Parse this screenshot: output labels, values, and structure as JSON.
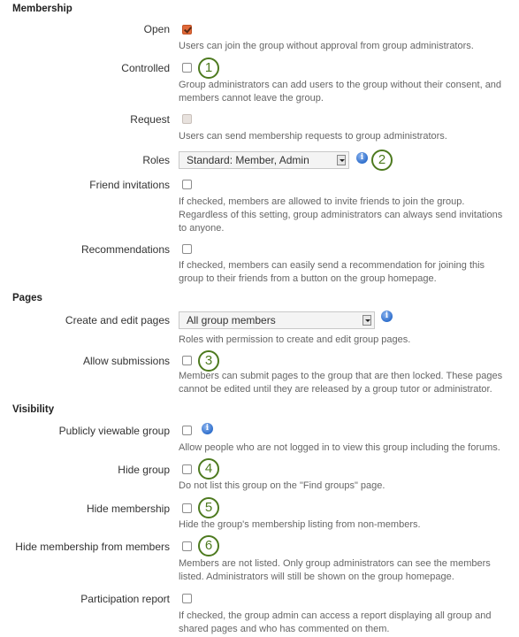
{
  "sections": {
    "membership": "Membership",
    "pages": "Pages",
    "visibility": "Visibility"
  },
  "fields": {
    "open": {
      "label": "Open",
      "checked": true,
      "desc": "Users can join the group without approval from group administrators."
    },
    "controlled": {
      "label": "Controlled",
      "checked": false,
      "callout": "1",
      "desc": "Group administrators can add users to the group without their consent, and members cannot leave the group."
    },
    "request": {
      "label": "Request",
      "checked": false,
      "disabled": true,
      "desc": "Users can send membership requests to group administrators."
    },
    "roles": {
      "label": "Roles",
      "value": "Standard: Member, Admin",
      "callout": "2"
    },
    "friend_invitations": {
      "label": "Friend invitations",
      "checked": false,
      "desc": "If checked, members are allowed to invite friends to join the group. Regardless of this setting, group administrators can always send invitations to anyone."
    },
    "recommendations": {
      "label": "Recommendations",
      "checked": false,
      "desc": "If checked, members can easily send a recommendation for joining this group to their friends from a button on the group homepage."
    },
    "create_edit_pages": {
      "label": "Create and edit pages",
      "value": "All group members",
      "desc": "Roles with permission to create and edit group pages."
    },
    "allow_submissions": {
      "label": "Allow submissions",
      "checked": false,
      "callout": "3",
      "desc": "Members can submit pages to the group that are then locked. These pages cannot be edited until they are released by a group tutor or administrator."
    },
    "publicly_viewable": {
      "label": "Publicly viewable group",
      "checked": false,
      "desc": "Allow people who are not logged in to view this group including the forums."
    },
    "hide_group": {
      "label": "Hide group",
      "checked": false,
      "callout": "4",
      "desc": "Do not list this group on the \"Find groups\" page."
    },
    "hide_membership": {
      "label": "Hide membership",
      "checked": false,
      "callout": "5",
      "desc": "Hide the group's membership listing from non-members."
    },
    "hide_membership_members": {
      "label": "Hide membership from members",
      "checked": false,
      "callout": "6",
      "desc": "Members are not listed. Only group administrators can see the members listed. Administrators will still be shown on the group homepage."
    },
    "participation_report": {
      "label": "Participation report",
      "checked": false,
      "desc": "If checked, the group admin can access a report displaying all group and shared pages and who has commented on them."
    }
  },
  "icons": {
    "info": "i"
  },
  "colors": {
    "checkbox_checked": "#e0693a",
    "callout_green": "#4d7a1f",
    "info_blue": "#2f6fcc"
  }
}
